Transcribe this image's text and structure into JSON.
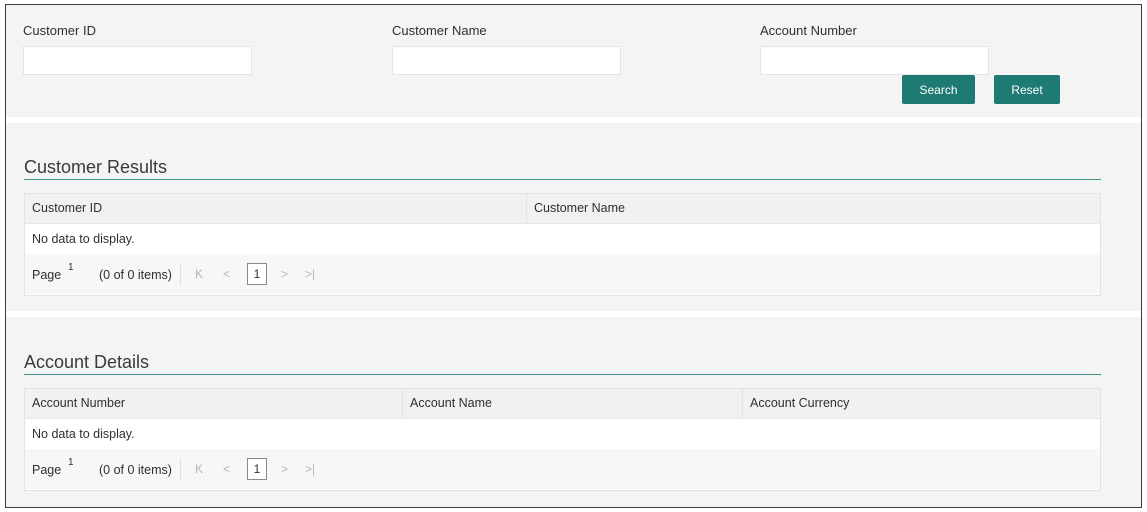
{
  "search": {
    "fields": [
      {
        "label": "Customer ID",
        "value": "",
        "placeholder": ""
      },
      {
        "label": "Customer Name",
        "value": "",
        "placeholder": ""
      },
      {
        "label": "Account Number",
        "value": "",
        "placeholder": ""
      }
    ],
    "search_label": "Search",
    "reset_label": "Reset"
  },
  "customer_results": {
    "title": "Customer Results",
    "columns": [
      "Customer ID",
      "Customer Name"
    ],
    "empty_text": "No data to display.",
    "pager": {
      "page_label": "Page",
      "page_number": "1",
      "info": "(0 of 0 items)",
      "first_icon": "K",
      "prev_icon": "<",
      "current": "1",
      "next_icon": ">",
      "last_icon": ">|"
    }
  },
  "account_details": {
    "title": "Account Details",
    "columns": [
      "Account Number",
      "Account Name",
      "Account Currency"
    ],
    "empty_text": "No data to display.",
    "pager": {
      "page_label": "Page",
      "page_number": "1",
      "info": "(0 of 0 items)",
      "first_icon": "K",
      "prev_icon": "<",
      "current": "1",
      "next_icon": ">",
      "last_icon": ">|"
    }
  },
  "colors": {
    "accent": "#1e7a73",
    "rule": "#3f8f89",
    "panel_bg": "#f4f4f4"
  }
}
